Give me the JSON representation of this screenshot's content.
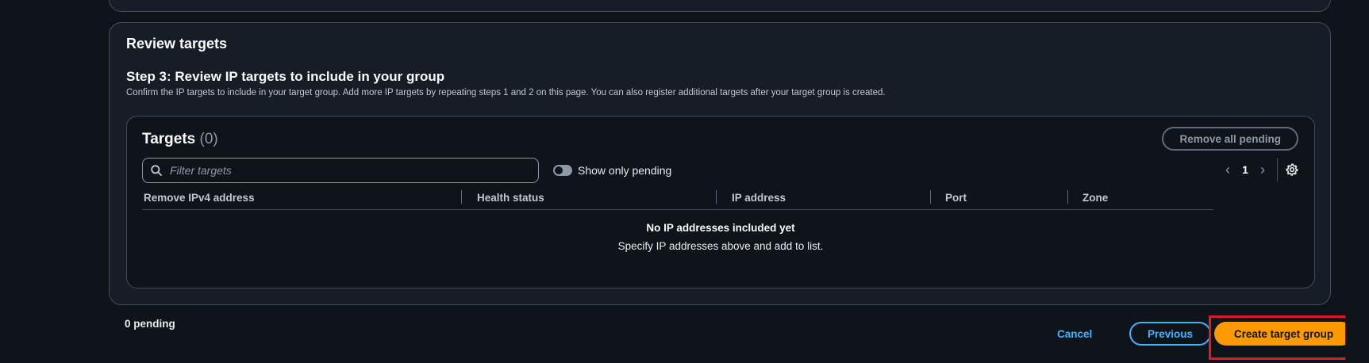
{
  "review": {
    "title": "Review targets",
    "step_title": "Step 3: Review IP targets to include in your group",
    "step_description": "Confirm the IP targets to include in your target group. Add more IP targets by repeating steps 1 and 2 on this page. You can also register additional targets after your target group is created."
  },
  "targets": {
    "heading": "Targets",
    "count": "(0)",
    "remove_all_label": "Remove all pending",
    "filter_placeholder": "Filter targets",
    "toggle_label": "Show only pending",
    "toggle_on": false,
    "page_number": "1",
    "columns": [
      "Remove IPv4 address",
      "Health status",
      "IP address",
      "Port",
      "Zone"
    ],
    "empty_title": "No IP addresses included yet",
    "empty_subtitle": "Specify IP addresses above and add to list."
  },
  "footer": {
    "pending_text": "0 pending",
    "cancel_label": "Cancel",
    "previous_label": "Previous",
    "create_label": "Create target group"
  },
  "colors": {
    "background": "#0f141a",
    "panel": "#161d26",
    "border": "#414d5c",
    "primary_button": "#ff9900",
    "link": "#42b4ff",
    "highlight": "#e01c22"
  }
}
